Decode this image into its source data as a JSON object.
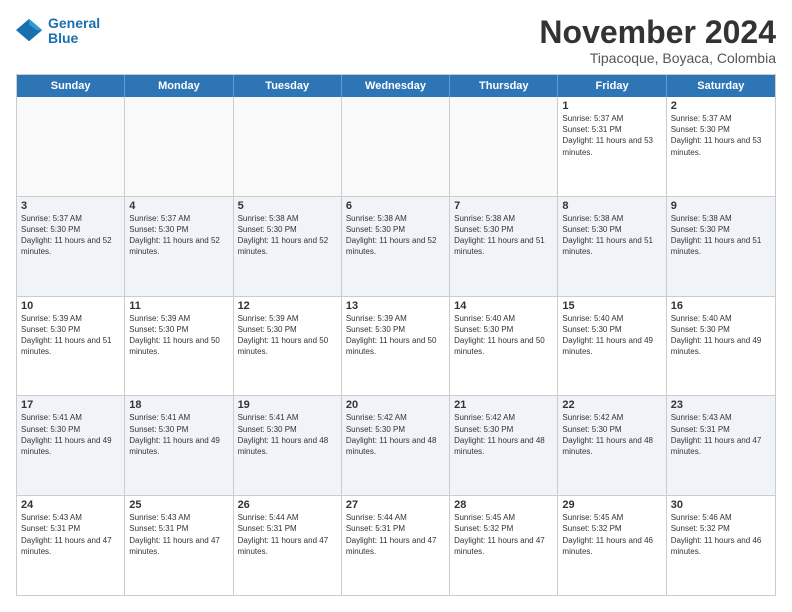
{
  "header": {
    "logo_line1": "General",
    "logo_line2": "Blue",
    "month": "November 2024",
    "location": "Tipacoque, Boyaca, Colombia"
  },
  "weekdays": [
    "Sunday",
    "Monday",
    "Tuesday",
    "Wednesday",
    "Thursday",
    "Friday",
    "Saturday"
  ],
  "rows": [
    [
      {
        "day": "",
        "sunrise": "",
        "sunset": "",
        "daylight": "",
        "empty": true
      },
      {
        "day": "",
        "sunrise": "",
        "sunset": "",
        "daylight": "",
        "empty": true
      },
      {
        "day": "",
        "sunrise": "",
        "sunset": "",
        "daylight": "",
        "empty": true
      },
      {
        "day": "",
        "sunrise": "",
        "sunset": "",
        "daylight": "",
        "empty": true
      },
      {
        "day": "",
        "sunrise": "",
        "sunset": "",
        "daylight": "",
        "empty": true
      },
      {
        "day": "1",
        "sunrise": "Sunrise: 5:37 AM",
        "sunset": "Sunset: 5:31 PM",
        "daylight": "Daylight: 11 hours and 53 minutes.",
        "empty": false
      },
      {
        "day": "2",
        "sunrise": "Sunrise: 5:37 AM",
        "sunset": "Sunset: 5:30 PM",
        "daylight": "Daylight: 11 hours and 53 minutes.",
        "empty": false
      }
    ],
    [
      {
        "day": "3",
        "sunrise": "Sunrise: 5:37 AM",
        "sunset": "Sunset: 5:30 PM",
        "daylight": "Daylight: 11 hours and 52 minutes.",
        "empty": false
      },
      {
        "day": "4",
        "sunrise": "Sunrise: 5:37 AM",
        "sunset": "Sunset: 5:30 PM",
        "daylight": "Daylight: 11 hours and 52 minutes.",
        "empty": false
      },
      {
        "day": "5",
        "sunrise": "Sunrise: 5:38 AM",
        "sunset": "Sunset: 5:30 PM",
        "daylight": "Daylight: 11 hours and 52 minutes.",
        "empty": false
      },
      {
        "day": "6",
        "sunrise": "Sunrise: 5:38 AM",
        "sunset": "Sunset: 5:30 PM",
        "daylight": "Daylight: 11 hours and 52 minutes.",
        "empty": false
      },
      {
        "day": "7",
        "sunrise": "Sunrise: 5:38 AM",
        "sunset": "Sunset: 5:30 PM",
        "daylight": "Daylight: 11 hours and 51 minutes.",
        "empty": false
      },
      {
        "day": "8",
        "sunrise": "Sunrise: 5:38 AM",
        "sunset": "Sunset: 5:30 PM",
        "daylight": "Daylight: 11 hours and 51 minutes.",
        "empty": false
      },
      {
        "day": "9",
        "sunrise": "Sunrise: 5:38 AM",
        "sunset": "Sunset: 5:30 PM",
        "daylight": "Daylight: 11 hours and 51 minutes.",
        "empty": false
      }
    ],
    [
      {
        "day": "10",
        "sunrise": "Sunrise: 5:39 AM",
        "sunset": "Sunset: 5:30 PM",
        "daylight": "Daylight: 11 hours and 51 minutes.",
        "empty": false
      },
      {
        "day": "11",
        "sunrise": "Sunrise: 5:39 AM",
        "sunset": "Sunset: 5:30 PM",
        "daylight": "Daylight: 11 hours and 50 minutes.",
        "empty": false
      },
      {
        "day": "12",
        "sunrise": "Sunrise: 5:39 AM",
        "sunset": "Sunset: 5:30 PM",
        "daylight": "Daylight: 11 hours and 50 minutes.",
        "empty": false
      },
      {
        "day": "13",
        "sunrise": "Sunrise: 5:39 AM",
        "sunset": "Sunset: 5:30 PM",
        "daylight": "Daylight: 11 hours and 50 minutes.",
        "empty": false
      },
      {
        "day": "14",
        "sunrise": "Sunrise: 5:40 AM",
        "sunset": "Sunset: 5:30 PM",
        "daylight": "Daylight: 11 hours and 50 minutes.",
        "empty": false
      },
      {
        "day": "15",
        "sunrise": "Sunrise: 5:40 AM",
        "sunset": "Sunset: 5:30 PM",
        "daylight": "Daylight: 11 hours and 49 minutes.",
        "empty": false
      },
      {
        "day": "16",
        "sunrise": "Sunrise: 5:40 AM",
        "sunset": "Sunset: 5:30 PM",
        "daylight": "Daylight: 11 hours and 49 minutes.",
        "empty": false
      }
    ],
    [
      {
        "day": "17",
        "sunrise": "Sunrise: 5:41 AM",
        "sunset": "Sunset: 5:30 PM",
        "daylight": "Daylight: 11 hours and 49 minutes.",
        "empty": false
      },
      {
        "day": "18",
        "sunrise": "Sunrise: 5:41 AM",
        "sunset": "Sunset: 5:30 PM",
        "daylight": "Daylight: 11 hours and 49 minutes.",
        "empty": false
      },
      {
        "day": "19",
        "sunrise": "Sunrise: 5:41 AM",
        "sunset": "Sunset: 5:30 PM",
        "daylight": "Daylight: 11 hours and 48 minutes.",
        "empty": false
      },
      {
        "day": "20",
        "sunrise": "Sunrise: 5:42 AM",
        "sunset": "Sunset: 5:30 PM",
        "daylight": "Daylight: 11 hours and 48 minutes.",
        "empty": false
      },
      {
        "day": "21",
        "sunrise": "Sunrise: 5:42 AM",
        "sunset": "Sunset: 5:30 PM",
        "daylight": "Daylight: 11 hours and 48 minutes.",
        "empty": false
      },
      {
        "day": "22",
        "sunrise": "Sunrise: 5:42 AM",
        "sunset": "Sunset: 5:30 PM",
        "daylight": "Daylight: 11 hours and 48 minutes.",
        "empty": false
      },
      {
        "day": "23",
        "sunrise": "Sunrise: 5:43 AM",
        "sunset": "Sunset: 5:31 PM",
        "daylight": "Daylight: 11 hours and 47 minutes.",
        "empty": false
      }
    ],
    [
      {
        "day": "24",
        "sunrise": "Sunrise: 5:43 AM",
        "sunset": "Sunset: 5:31 PM",
        "daylight": "Daylight: 11 hours and 47 minutes.",
        "empty": false
      },
      {
        "day": "25",
        "sunrise": "Sunrise: 5:43 AM",
        "sunset": "Sunset: 5:31 PM",
        "daylight": "Daylight: 11 hours and 47 minutes.",
        "empty": false
      },
      {
        "day": "26",
        "sunrise": "Sunrise: 5:44 AM",
        "sunset": "Sunset: 5:31 PM",
        "daylight": "Daylight: 11 hours and 47 minutes.",
        "empty": false
      },
      {
        "day": "27",
        "sunrise": "Sunrise: 5:44 AM",
        "sunset": "Sunset: 5:31 PM",
        "daylight": "Daylight: 11 hours and 47 minutes.",
        "empty": false
      },
      {
        "day": "28",
        "sunrise": "Sunrise: 5:45 AM",
        "sunset": "Sunset: 5:32 PM",
        "daylight": "Daylight: 11 hours and 47 minutes.",
        "empty": false
      },
      {
        "day": "29",
        "sunrise": "Sunrise: 5:45 AM",
        "sunset": "Sunset: 5:32 PM",
        "daylight": "Daylight: 11 hours and 46 minutes.",
        "empty": false
      },
      {
        "day": "30",
        "sunrise": "Sunrise: 5:46 AM",
        "sunset": "Sunset: 5:32 PM",
        "daylight": "Daylight: 11 hours and 46 minutes.",
        "empty": false
      }
    ]
  ]
}
